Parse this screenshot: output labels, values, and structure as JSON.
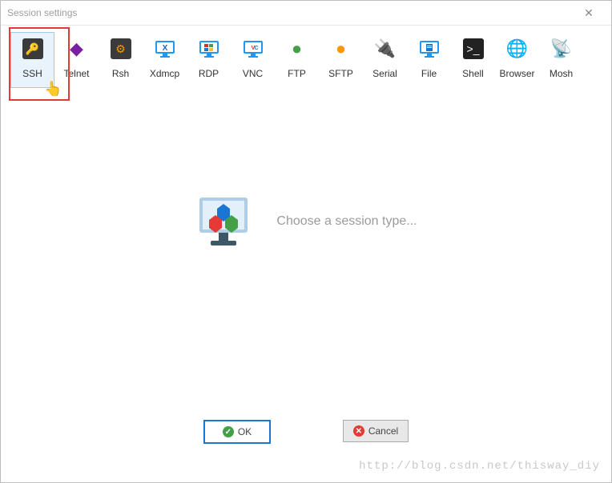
{
  "window": {
    "title": "Session settings"
  },
  "sessions": [
    {
      "id": "ssh",
      "label": "SSH",
      "selected": true
    },
    {
      "id": "telnet",
      "label": "Telnet",
      "selected": false
    },
    {
      "id": "rsh",
      "label": "Rsh",
      "selected": false
    },
    {
      "id": "xdmcp",
      "label": "Xdmcp",
      "selected": false
    },
    {
      "id": "rdp",
      "label": "RDP",
      "selected": false
    },
    {
      "id": "vnc",
      "label": "VNC",
      "selected": false
    },
    {
      "id": "ftp",
      "label": "FTP",
      "selected": false
    },
    {
      "id": "sftp",
      "label": "SFTP",
      "selected": false
    },
    {
      "id": "serial",
      "label": "Serial",
      "selected": false
    },
    {
      "id": "file",
      "label": "File",
      "selected": false
    },
    {
      "id": "shell",
      "label": "Shell",
      "selected": false
    },
    {
      "id": "browser",
      "label": "Browser",
      "selected": false
    },
    {
      "id": "mosh",
      "label": "Mosh",
      "selected": false
    }
  ],
  "center": {
    "message": "Choose a session type..."
  },
  "buttons": {
    "ok": "OK",
    "cancel": "Cancel"
  },
  "watermark": "http://blog.csdn.net/thisway_diy",
  "icons": {
    "ssh": {
      "bg": "#3b3b3b",
      "glyph": "🔑",
      "glyphColor": "#ffce3d"
    },
    "telnet": {
      "bg": "transparent",
      "glyph": "◆",
      "glyphColor": "#7b1fa2"
    },
    "rsh": {
      "bg": "#3b3b3b",
      "glyph": "⚙",
      "glyphColor": "#ff9800"
    },
    "xdmcp": {
      "bg": "transparent",
      "svg": "monitor-x"
    },
    "rdp": {
      "bg": "transparent",
      "svg": "monitor-win"
    },
    "vnc": {
      "bg": "transparent",
      "svg": "monitor-vnc"
    },
    "ftp": {
      "bg": "transparent",
      "glyph": "●",
      "glyphColor": "#43a047"
    },
    "sftp": {
      "bg": "transparent",
      "glyph": "●",
      "glyphColor": "#ff9800"
    },
    "serial": {
      "bg": "transparent",
      "glyph": "🔌",
      "glyphColor": "#888"
    },
    "file": {
      "bg": "transparent",
      "svg": "monitor-file"
    },
    "shell": {
      "bg": "#222",
      "glyph": ">_",
      "glyphColor": "#fff"
    },
    "browser": {
      "bg": "transparent",
      "glyph": "🌐",
      "glyphColor": "#2196f3"
    },
    "mosh": {
      "bg": "transparent",
      "glyph": "📡",
      "glyphColor": "#2196f3"
    }
  }
}
